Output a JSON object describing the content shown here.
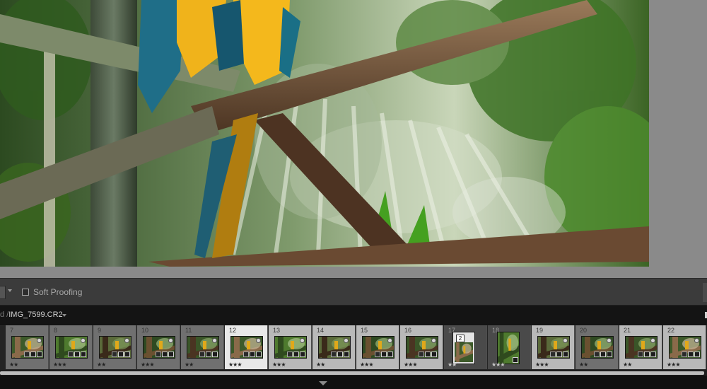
{
  "toolbar": {
    "soft_proofing_label": "Soft Proofing",
    "soft_proofing_checked": false
  },
  "filmstrip_header": {
    "path_prefix": "d /",
    "filename": "IMG_7599.CR2"
  },
  "filmstrip": {
    "cells": [
      {
        "number": "7",
        "stars": "★★",
        "state": "normal"
      },
      {
        "number": "8",
        "stars": "★★★",
        "state": "normal"
      },
      {
        "number": "9",
        "stars": "★★",
        "state": "normal"
      },
      {
        "number": "10",
        "stars": "★★★",
        "state": "normal"
      },
      {
        "number": "11",
        "stars": "★★",
        "state": "normal"
      },
      {
        "number": "12",
        "stars": "★★★",
        "state": "active"
      },
      {
        "number": "13",
        "stars": "★★★",
        "state": "selected"
      },
      {
        "number": "14",
        "stars": "★★",
        "state": "selected"
      },
      {
        "number": "15",
        "stars": "★★★",
        "state": "selected"
      },
      {
        "number": "16",
        "stars": "★★★",
        "state": "selected"
      },
      {
        "number": "17",
        "stars": "★★",
        "state": "stack",
        "stack_count": "2"
      },
      {
        "number": "18",
        "stars": "★★★",
        "state": "stack-child"
      },
      {
        "number": "19",
        "stars": "★★★",
        "state": "selected"
      },
      {
        "number": "20",
        "stars": "★★",
        "state": "normal"
      },
      {
        "number": "21",
        "stars": "★★",
        "state": "selected"
      },
      {
        "number": "22",
        "stars": "★★★",
        "state": "selected"
      }
    ]
  },
  "icons": {
    "edit_badge": "adjusted-icon",
    "crop_badge": "crop-icon",
    "metadata_badge": "metadata-icon",
    "collapse": "chevron-down-icon"
  },
  "colors": {
    "selected_cell": "#b9b9b9",
    "active_cell": "#e8e8e8",
    "normal_cell": "#707070"
  }
}
